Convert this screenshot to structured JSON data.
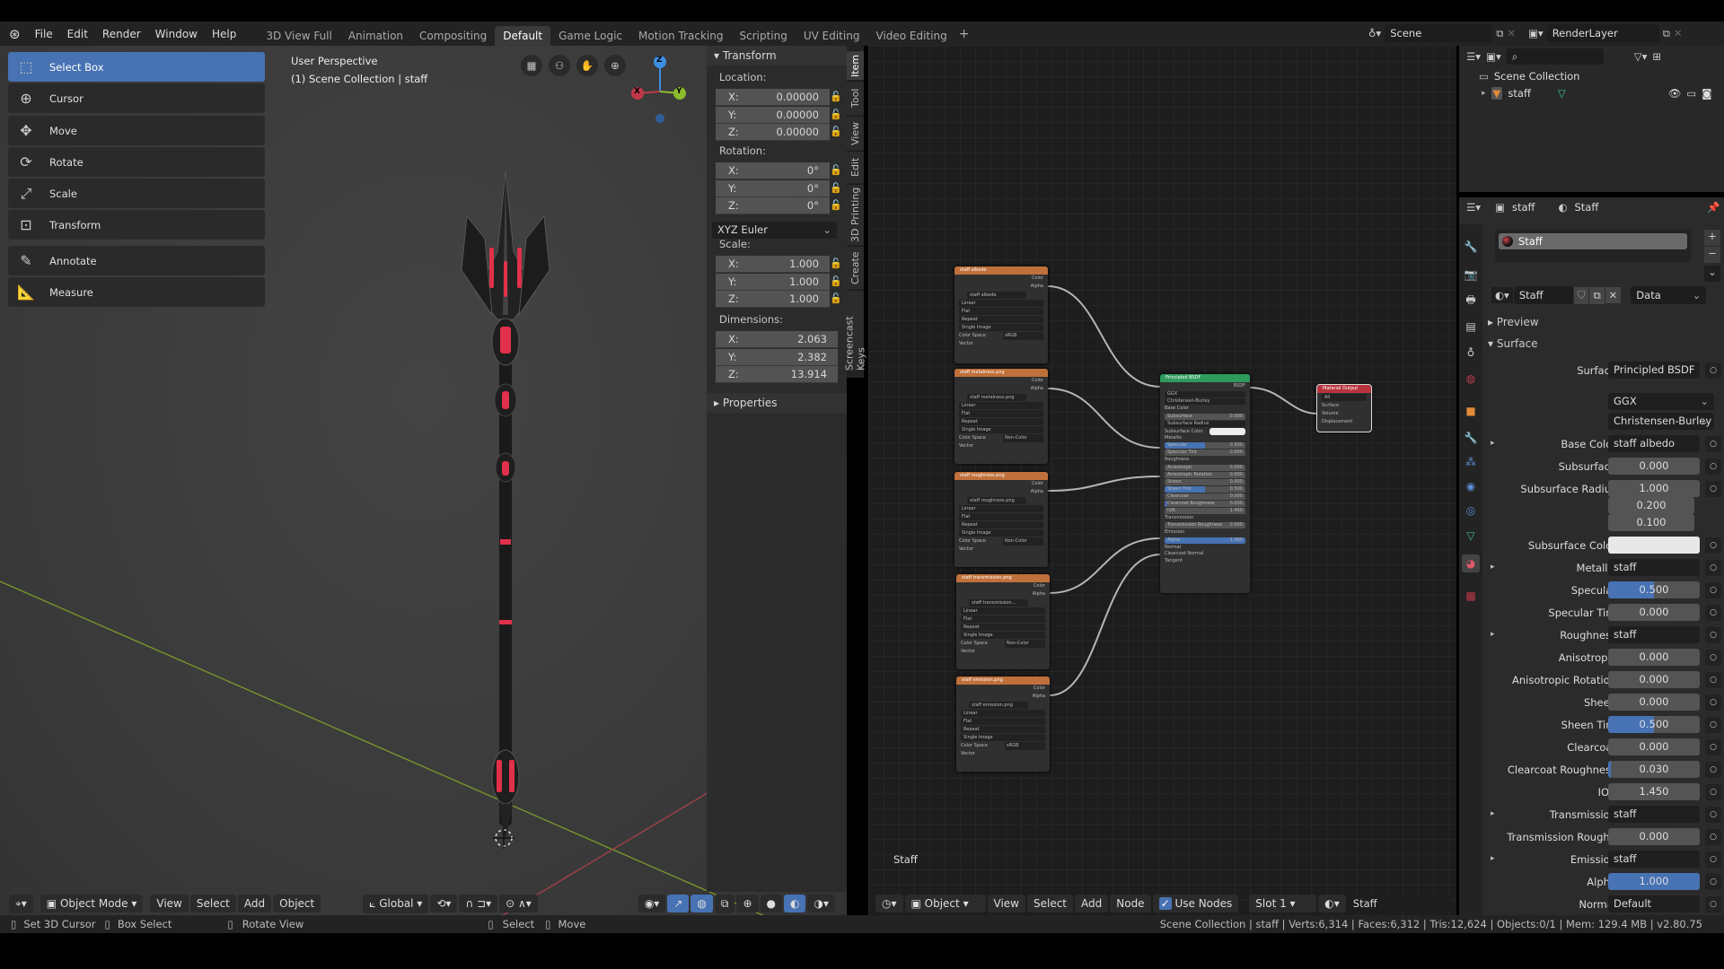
{
  "menu": {
    "items": [
      "File",
      "Edit",
      "Render",
      "Window",
      "Help"
    ]
  },
  "workspaces": {
    "tabs": [
      "3D View Full",
      "Animation",
      "Compositing",
      "Default",
      "Game Logic",
      "Motion Tracking",
      "Scripting",
      "UV Editing",
      "Video Editing"
    ],
    "active": "Default",
    "add_label": "+"
  },
  "scene": {
    "name": "Scene"
  },
  "render_layer": {
    "name": "RenderLayer"
  },
  "toolbar": {
    "tools": [
      "Select Box",
      "Cursor",
      "Move",
      "Rotate",
      "Scale",
      "Transform",
      "Annotate",
      "Measure"
    ],
    "active": "Select Box"
  },
  "viewport": {
    "perspective": "User Perspective",
    "collection": "(1) Scene Collection | staff",
    "gizmo": {
      "x": "X",
      "y": "Y",
      "z": "Z"
    },
    "header": {
      "mode": "Object Mode",
      "menus": [
        "View",
        "Select",
        "Add",
        "Object"
      ],
      "orientation": "Global"
    }
  },
  "npanel": {
    "tabs": [
      "Item",
      "Tool",
      "View",
      "Edit",
      "3D Printing",
      "Create",
      "Screencast Keys"
    ],
    "active_tab": "Item",
    "transform_title": "Transform",
    "location_label": "Location:",
    "location": [
      {
        "axis": "X:",
        "value": "0.00000"
      },
      {
        "axis": "Y:",
        "value": "0.00000"
      },
      {
        "axis": "Z:",
        "value": "0.00000"
      }
    ],
    "rotation_label": "Rotation:",
    "rotation": [
      {
        "axis": "X:",
        "value": "0°"
      },
      {
        "axis": "Y:",
        "value": "0°"
      },
      {
        "axis": "Z:",
        "value": "0°"
      }
    ],
    "rotation_mode": "XYZ Euler",
    "scale_label": "Scale:",
    "scale": [
      {
        "axis": "X:",
        "value": "1.000"
      },
      {
        "axis": "Y:",
        "value": "1.000"
      },
      {
        "axis": "Z:",
        "value": "1.000"
      }
    ],
    "dimensions_label": "Dimensions:",
    "dimensions": [
      {
        "axis": "X:",
        "value": "2.063"
      },
      {
        "axis": "Y:",
        "value": "2.382"
      },
      {
        "axis": "Z:",
        "value": "13.914"
      }
    ],
    "properties_title": "Properties"
  },
  "node_editor": {
    "header": {
      "object": "Object",
      "menus": [
        "View",
        "Select",
        "Add",
        "Node"
      ],
      "use_nodes": "Use Nodes",
      "use_nodes_checked": true,
      "slot": "Slot 1",
      "material": "Staff"
    },
    "material_label": "Staff",
    "image_nodes": [
      {
        "title": "staff albedo",
        "image": "staff albedo",
        "color_space": "sRGB"
      },
      {
        "title": "staff metalness.png",
        "image": "staff metalness.png",
        "color_space": "Non-Color"
      },
      {
        "title": "staff roughness.png",
        "image": "staff roughness.png",
        "color_space": "Non-Color"
      },
      {
        "title": "staff transmission.png",
        "image": "staff transmission...",
        "color_space": "Non-Color"
      },
      {
        "title": "staff emission.png",
        "image": "staff emission.png",
        "color_space": "sRGB"
      }
    ],
    "image_node_labels": {
      "color": "Color",
      "alpha": "Alpha",
      "interpolation": "Linear",
      "projection": "Flat",
      "extension": "Repeat",
      "source": "Single Image",
      "color_space": "Color Space",
      "vector": "Vector"
    },
    "principled": {
      "title": "Principled BSDF",
      "output": "BSDF",
      "rows": [
        {
          "label": "GGX",
          "type": "select"
        },
        {
          "label": "Christensen-Burley",
          "type": "select"
        },
        {
          "label": "Base Color",
          "type": "socket"
        },
        {
          "label": "Subsurface",
          "value": "0.000",
          "type": "num"
        },
        {
          "label": "Subsurface Radius",
          "type": "select"
        },
        {
          "label": "Subsurface Color",
          "type": "color"
        },
        {
          "label": "Metallic",
          "type": "socket"
        },
        {
          "label": "Specular",
          "value": "0.500",
          "type": "num",
          "fill": 0.5
        },
        {
          "label": "Specular Tint",
          "value": "0.000",
          "type": "num"
        },
        {
          "label": "Roughness",
          "type": "socket"
        },
        {
          "label": "Anisotropic",
          "value": "0.000",
          "type": "num"
        },
        {
          "label": "Anisotropic Rotation",
          "value": "0.000",
          "type": "num"
        },
        {
          "label": "Sheen",
          "value": "0.000",
          "type": "num"
        },
        {
          "label": "Sheen Tint",
          "value": "0.500",
          "type": "num",
          "fill": 0.5
        },
        {
          "label": "Clearcoat",
          "value": "0.000",
          "type": "num"
        },
        {
          "label": "Clearcoat Roughness",
          "value": "0.030",
          "type": "num",
          "fill": 0.03
        },
        {
          "label": "IOR",
          "value": "1.450",
          "type": "num"
        },
        {
          "label": "Transmission",
          "type": "socket"
        },
        {
          "label": "Transmission Roughness",
          "value": "0.000",
          "type": "num"
        },
        {
          "label": "Emission",
          "type": "socket"
        },
        {
          "label": "Alpha",
          "value": "1.000",
          "type": "num",
          "fill": 1
        },
        {
          "label": "Normal",
          "type": "socket"
        },
        {
          "label": "Clearcoat Normal",
          "type": "socket"
        },
        {
          "label": "Tangent",
          "type": "socket"
        }
      ]
    },
    "material_output": {
      "title": "Material Output",
      "target": "All",
      "inputs": [
        "Surface",
        "Volume",
        "Displacement"
      ]
    }
  },
  "outliner": {
    "root": "Scene Collection",
    "object": "staff"
  },
  "properties": {
    "header_object": "staff",
    "header_material": "Staff",
    "slot": "Staff",
    "material_name": "Staff",
    "link": "Data",
    "preview_label": "Preview",
    "surface_label": "Surface",
    "rows": [
      {
        "label": "Surface",
        "value": "Principled BSDF",
        "type": "text"
      },
      {
        "label": "",
        "value": "GGX",
        "type": "sel"
      },
      {
        "label": "",
        "value": "Christensen-Burley",
        "type": "sel"
      },
      {
        "label": "Base Color",
        "value": "staff albedo",
        "type": "text",
        "expand": true
      },
      {
        "label": "Subsurface",
        "value": "0.000",
        "type": "num",
        "fill": 0
      },
      {
        "label": "Subsurface Radius",
        "value": "1.000",
        "type": "num",
        "fill": 0
      },
      {
        "label": "",
        "value": "0.200",
        "type": "num",
        "fill": 0,
        "nodot": true
      },
      {
        "label": "",
        "value": "0.100",
        "type": "num",
        "fill": 0,
        "nodot": true
      },
      {
        "label": "Subsurface Color",
        "value": "",
        "type": "color",
        "color": "#e8e8e8"
      },
      {
        "label": "Metallic",
        "value": "staff metalness.pn",
        "type": "text",
        "expand": true
      },
      {
        "label": "Specular",
        "value": "0.500",
        "type": "num",
        "fill": 0.5
      },
      {
        "label": "Specular Tint",
        "value": "0.000",
        "type": "num",
        "fill": 0
      },
      {
        "label": "Roughness",
        "value": "staff roughness.png",
        "type": "text",
        "expand": true
      },
      {
        "label": "Anisotropic",
        "value": "0.000",
        "type": "num",
        "fill": 0
      },
      {
        "label": "Anisotropic Rotation",
        "value": "0.000",
        "type": "num",
        "fill": 0
      },
      {
        "label": "Sheen",
        "value": "0.000",
        "type": "num",
        "fill": 0
      },
      {
        "label": "Sheen Tint",
        "value": "0.500",
        "type": "num",
        "fill": 0.5
      },
      {
        "label": "Clearcoat",
        "value": "0.000",
        "type": "num",
        "fill": 0
      },
      {
        "label": "Clearcoat Roughness",
        "value": "0.030",
        "type": "num",
        "fill": 0.03
      },
      {
        "label": "IOR",
        "value": "1.450",
        "type": "num",
        "fill": 0
      },
      {
        "label": "Transmission",
        "value": "staff transmission..",
        "type": "text",
        "expand": true
      },
      {
        "label": "Transmission Rough..",
        "value": "0.000",
        "type": "num",
        "fill": 0
      },
      {
        "label": "Emission",
        "value": "staff emission.png",
        "type": "text",
        "expand": true
      },
      {
        "label": "Alpha",
        "value": "1.000",
        "type": "num",
        "fill": 1
      },
      {
        "label": "Normal",
        "value": "Default",
        "type": "text"
      }
    ]
  },
  "statusbar": {
    "hints": [
      "Set 3D Cursor",
      "Box Select",
      "Rotate View",
      "Select",
      "Move"
    ],
    "stats": "Scene Collection | staff | Verts:6,314 | Faces:6,312 | Tris:12,624 | Objects:0/1 | Mem: 129.4 MB | v2.80.75"
  },
  "colors": {
    "accent": "#4772b3",
    "node_texture": "#c0703a",
    "node_shader": "#2f9a5c",
    "node_output": "#b8343c",
    "axis_x": "#c0394a",
    "axis_y": "#8bbb2c",
    "axis_z": "#3d8ee0",
    "staff_glow": "#e0304a"
  }
}
